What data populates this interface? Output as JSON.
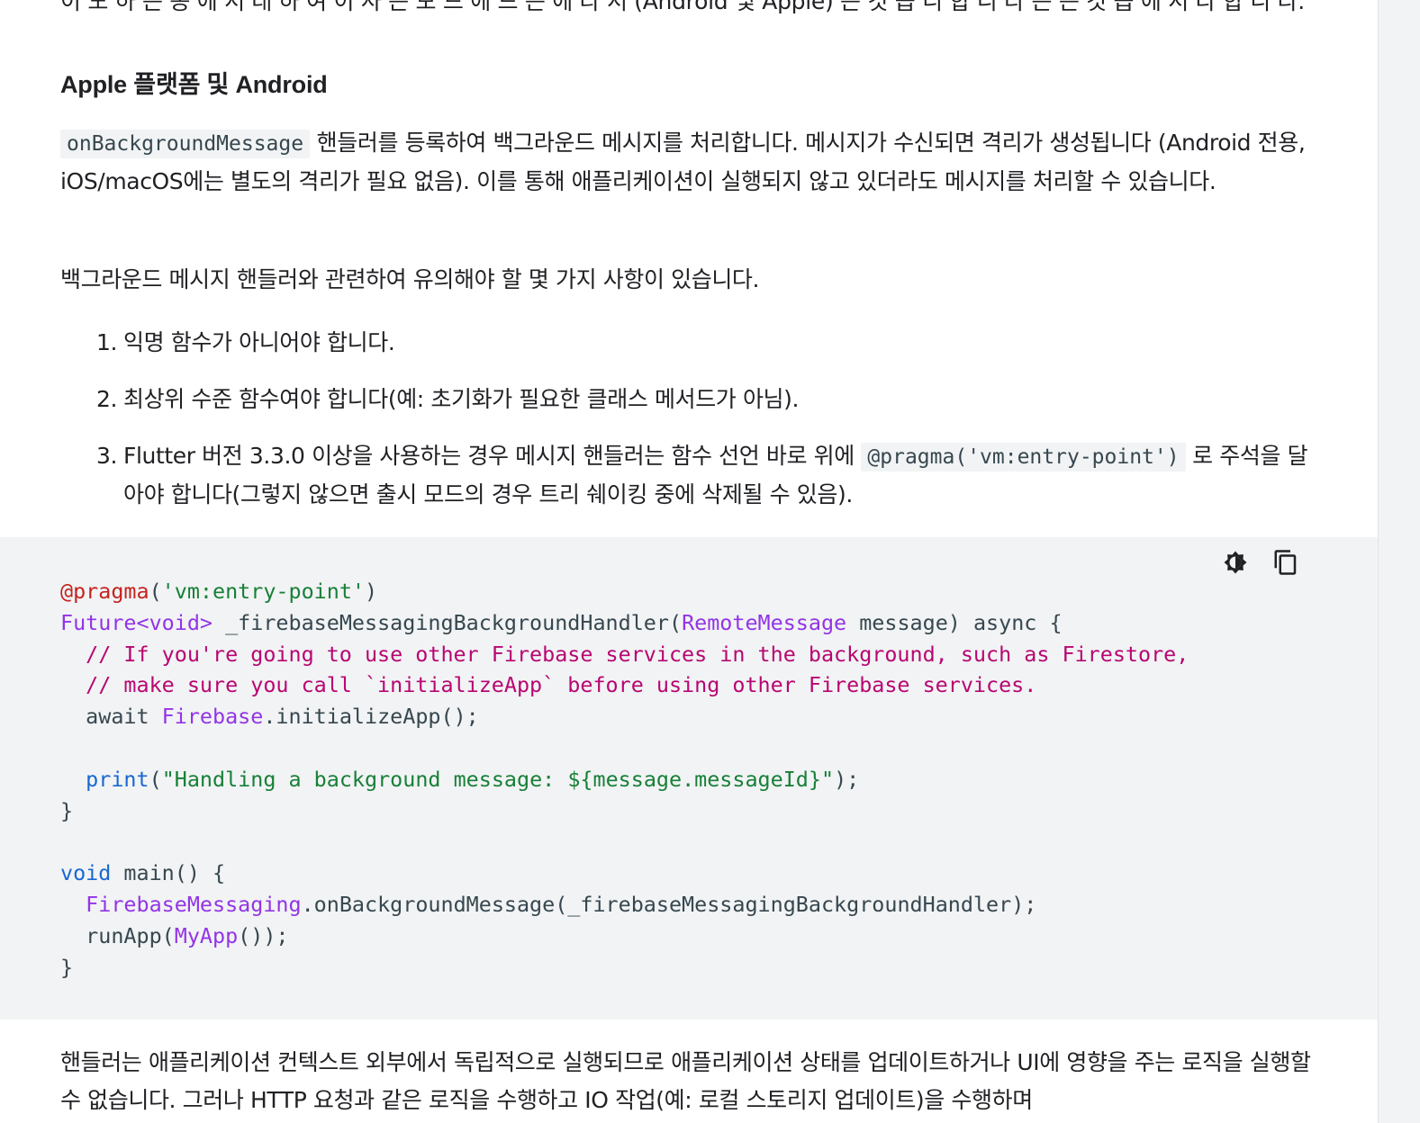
{
  "top_cut_text": "이 도 하 는 동 에 서 대 하 여 이 사 는 모 드 에 드 는 에 라 서 (Android 및 Apple) 는 것 습 니 합 니 다 는 는 것 습 에 서 다 합 니 다.",
  "section_heading": "Apple 플랫폼 및 Android",
  "intro": {
    "code": "onBackgroundMessage",
    "text_after_code": " 핸들러를 등록하여 백그라운드 메시지를 처리합니다. 메시지가 수신되면 격리가 생성됩니다 (Android 전용, iOS/macOS에는 별도의 격리가 필요 없음). 이를 통해 애플리케이션이 실행되지 않고 있더라도 메시지를 처리할 수 있습니다."
  },
  "notes_intro": "백그라운드 메시지 핸들러와 관련하여 유의해야 할 몇 가지 사항이 있습니다.",
  "notes": [
    {
      "num": "1.",
      "text": "익명 함수가 아니어야 합니다."
    },
    {
      "num": "2.",
      "text": "최상위 수준 함수여야 합니다(예: 초기화가 필요한 클래스 메서드가 아님)."
    },
    {
      "num": "3.",
      "text_before": "Flutter 버전 3.3.0 이상을 사용하는 경우 메시지 핸들러는 함수 선언 바로 위에 ",
      "code": "@pragma('vm:entry-point')",
      "text_after": " 로 주석을 달아야 합니다(그렇지 않으면 출시 모드의 경우 트리 쉐이킹 중에 삭제될 수 있음)."
    }
  ],
  "code_tools": {
    "theme_icon": "brightness-icon",
    "copy_icon": "copy-icon"
  },
  "code_lines": [
    [
      {
        "t": "@pragma",
        "c": "annot"
      },
      {
        "t": "(",
        "c": "plain"
      },
      {
        "t": "'vm:entry-point'",
        "c": "str"
      },
      {
        "t": ")",
        "c": "plain"
      }
    ],
    [
      {
        "t": "Future",
        "c": "type"
      },
      {
        "t": "<void>",
        "c": "type"
      },
      {
        "t": " _firebaseMessagingBackgroundHandler(",
        "c": "plain"
      },
      {
        "t": "RemoteMessage",
        "c": "type"
      },
      {
        "t": " message) async {",
        "c": "plain"
      }
    ],
    [
      {
        "t": "  // If you're going to use other Firebase services in the background, such as Firestore,",
        "c": "comment"
      }
    ],
    [
      {
        "t": "  // make sure you call `initializeApp` before using other Firebase services.",
        "c": "comment"
      }
    ],
    [
      {
        "t": "  await ",
        "c": "plain"
      },
      {
        "t": "Firebase",
        "c": "type"
      },
      {
        "t": ".initializeApp();",
        "c": "plain"
      }
    ],
    [
      {
        "t": "",
        "c": "plain"
      }
    ],
    [
      {
        "t": "  ",
        "c": "plain"
      },
      {
        "t": "print",
        "c": "kw"
      },
      {
        "t": "(",
        "c": "plain"
      },
      {
        "t": "\"Handling a background message: ${message.messageId}\"",
        "c": "str"
      },
      {
        "t": ");",
        "c": "plain"
      }
    ],
    [
      {
        "t": "}",
        "c": "plain"
      }
    ],
    [
      {
        "t": "",
        "c": "plain"
      }
    ],
    [
      {
        "t": "void",
        "c": "kw"
      },
      {
        "t": " main() {",
        "c": "plain"
      }
    ],
    [
      {
        "t": "  ",
        "c": "plain"
      },
      {
        "t": "FirebaseMessaging",
        "c": "type"
      },
      {
        "t": ".onBackgroundMessage(_firebaseMessagingBackgroundHandler);",
        "c": "plain"
      }
    ],
    [
      {
        "t": "  runApp(",
        "c": "plain"
      },
      {
        "t": "MyApp",
        "c": "type"
      },
      {
        "t": "());",
        "c": "plain"
      }
    ],
    [
      {
        "t": "}",
        "c": "plain"
      }
    ]
  ],
  "outro": "핸들러는 애플리케이션 컨텍스트 외부에서 독립적으로 실행되므로 애플리케이션 상태를 업데이트하거나 UI에 영향을 주는 로직을 실행할 수 없습니다. 그러나 HTTP 요청과 같은 로직을 수행하고 IO 작업(예: 로컬 스토리지 업데이트)을 수행하며"
}
